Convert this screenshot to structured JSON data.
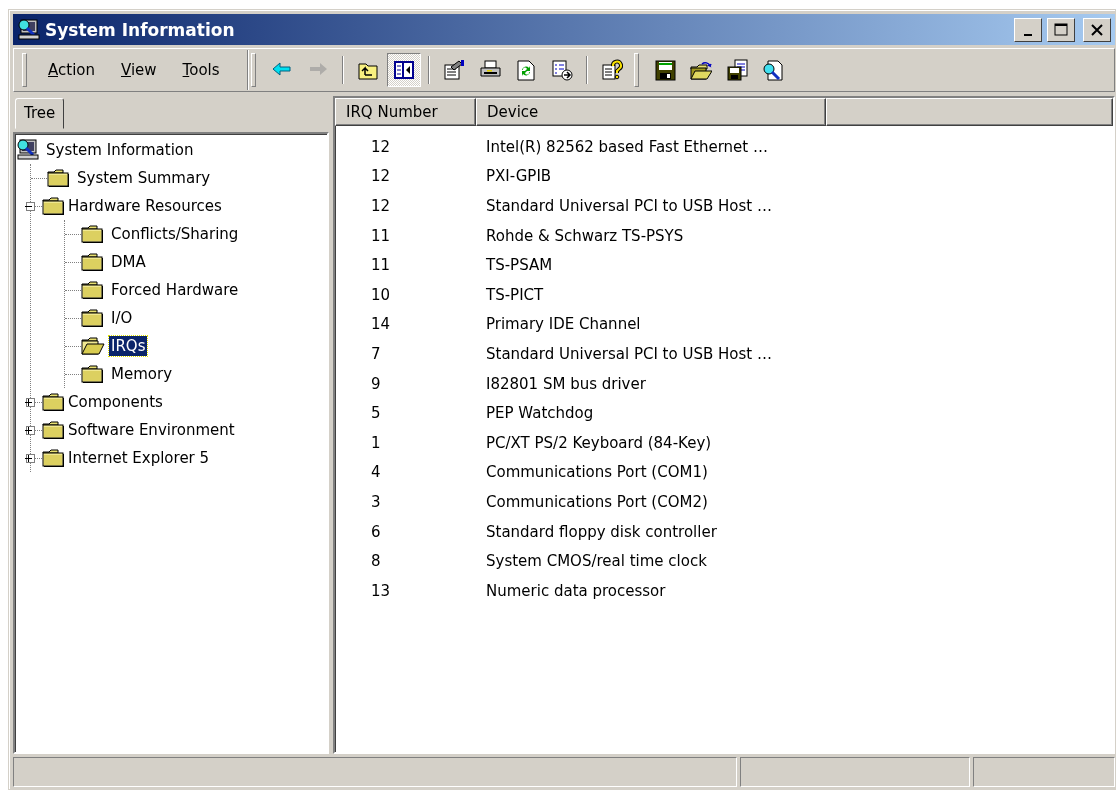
{
  "window": {
    "title": "System Information"
  },
  "menu": [
    {
      "label": "Action"
    },
    {
      "label": "View"
    },
    {
      "label": "Tools"
    }
  ],
  "toolbar_groups": [
    [
      {
        "kind": "back",
        "disabled": false,
        "pressed": false
      },
      {
        "kind": "forward",
        "disabled": true,
        "pressed": false
      }
    ],
    [
      {
        "kind": "up",
        "disabled": false,
        "pressed": false
      },
      {
        "kind": "show-tree",
        "disabled": false,
        "pressed": true
      }
    ],
    [
      {
        "kind": "properties",
        "disabled": false,
        "pressed": false
      },
      {
        "kind": "print",
        "disabled": false,
        "pressed": false
      },
      {
        "kind": "refresh",
        "disabled": false,
        "pressed": false
      },
      {
        "kind": "export",
        "disabled": false,
        "pressed": false
      }
    ],
    [
      {
        "kind": "help",
        "disabled": false,
        "pressed": false
      }
    ],
    [
      {
        "kind": "save",
        "disabled": false,
        "pressed": false
      },
      {
        "kind": "open",
        "disabled": false,
        "pressed": false
      },
      {
        "kind": "save-as",
        "disabled": false,
        "pressed": false
      },
      {
        "kind": "find",
        "disabled": false,
        "pressed": false
      }
    ]
  ],
  "tabs": [
    {
      "label": "Tree",
      "selected": true
    }
  ],
  "tree": [
    {
      "label": "System Information",
      "kind": "computer",
      "selected": false,
      "children": [
        {
          "label": "System Summary",
          "kind": "folder",
          "selected": false
        },
        {
          "label": "Hardware Resources",
          "kind": "folder",
          "selected": false,
          "expanded": true,
          "children": [
            {
              "label": "Conflicts/Sharing",
              "kind": "folder",
              "selected": false
            },
            {
              "label": "DMA",
              "kind": "folder",
              "selected": false
            },
            {
              "label": "Forced Hardware",
              "kind": "folder",
              "selected": false
            },
            {
              "label": "I/O",
              "kind": "folder",
              "selected": false
            },
            {
              "label": "IRQs",
              "kind": "folder",
              "selected": true
            },
            {
              "label": "Memory",
              "kind": "folder",
              "selected": false
            }
          ]
        },
        {
          "label": "Components",
          "kind": "folder",
          "selected": false,
          "expanded": false
        },
        {
          "label": "Software Environment",
          "kind": "folder",
          "selected": false,
          "expanded": false
        },
        {
          "label": "Internet Explorer 5",
          "kind": "folder",
          "selected": false,
          "expanded": false
        }
      ]
    }
  ],
  "table": {
    "columns": [
      "IRQ Number",
      "Device"
    ],
    "rows": [
      [
        "12",
        "Intel(R) 82562 based Fast Ethernet …"
      ],
      [
        "12",
        "PXI-GPIB"
      ],
      [
        "12",
        "Standard Universal PCI to USB Host …"
      ],
      [
        "11",
        "Rohde & Schwarz TS-PSYS"
      ],
      [
        "11",
        "TS-PSAM"
      ],
      [
        "10",
        "TS-PICT"
      ],
      [
        "14",
        "Primary IDE Channel"
      ],
      [
        "7",
        "Standard Universal PCI to USB Host …"
      ],
      [
        "9",
        "I82801 SM bus driver"
      ],
      [
        "5",
        "PEP Watchdog"
      ],
      [
        "1",
        "PC/XT PS/2 Keyboard (84-Key)"
      ],
      [
        "4",
        "Communications Port (COM1)"
      ],
      [
        "3",
        "Communications Port (COM2)"
      ],
      [
        "6",
        "Standard floppy disk controller"
      ],
      [
        "8",
        "System CMOS/real time clock"
      ],
      [
        "13",
        "Numeric data processor"
      ]
    ]
  }
}
